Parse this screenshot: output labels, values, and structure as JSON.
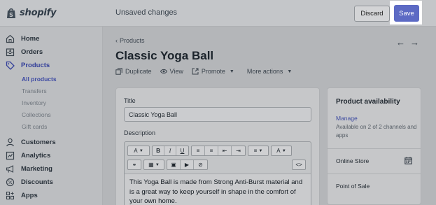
{
  "topbar": {
    "logo_text": "shopify",
    "status_text": "Unsaved changes",
    "discard_label": "Discard",
    "save_label": "Save",
    "accent_color": "#5c6ac4"
  },
  "sidebar": {
    "items": [
      {
        "label": "Home",
        "icon": "home-icon"
      },
      {
        "label": "Orders",
        "icon": "orders-icon"
      },
      {
        "label": "Products",
        "icon": "tag-icon"
      },
      {
        "label": "Customers",
        "icon": "customers-icon"
      },
      {
        "label": "Analytics",
        "icon": "analytics-icon"
      },
      {
        "label": "Marketing",
        "icon": "megaphone-icon"
      },
      {
        "label": "Discounts",
        "icon": "discount-icon"
      },
      {
        "label": "Apps",
        "icon": "apps-icon"
      }
    ],
    "product_subitems": [
      "All products",
      "Transfers",
      "Inventory",
      "Collections",
      "Gift cards"
    ],
    "active_item": "Products",
    "active_subitem": "All products"
  },
  "header": {
    "breadcrumb": "Products",
    "title": "Classic Yoga Ball",
    "actions": {
      "duplicate": "Duplicate",
      "view": "View",
      "promote": "Promote",
      "more": "More actions"
    }
  },
  "product_form": {
    "title_label": "Title",
    "title_value": "Classic Yoga Ball",
    "description_label": "Description",
    "description_text": "This Yoga Ball is made from Strong Anti-Burst material and is a great way to keep yourself in shape in the comfort of your own home.",
    "toolbar": {
      "font": "A",
      "bold": "B",
      "italic": "I",
      "underline": "U",
      "color": "A",
      "code": "<>"
    }
  },
  "availability": {
    "title": "Product availability",
    "manage_label": "Manage",
    "summary": "Available on 2 of 2 channels and apps",
    "channels": [
      "Online Store",
      "Point of Sale"
    ]
  }
}
